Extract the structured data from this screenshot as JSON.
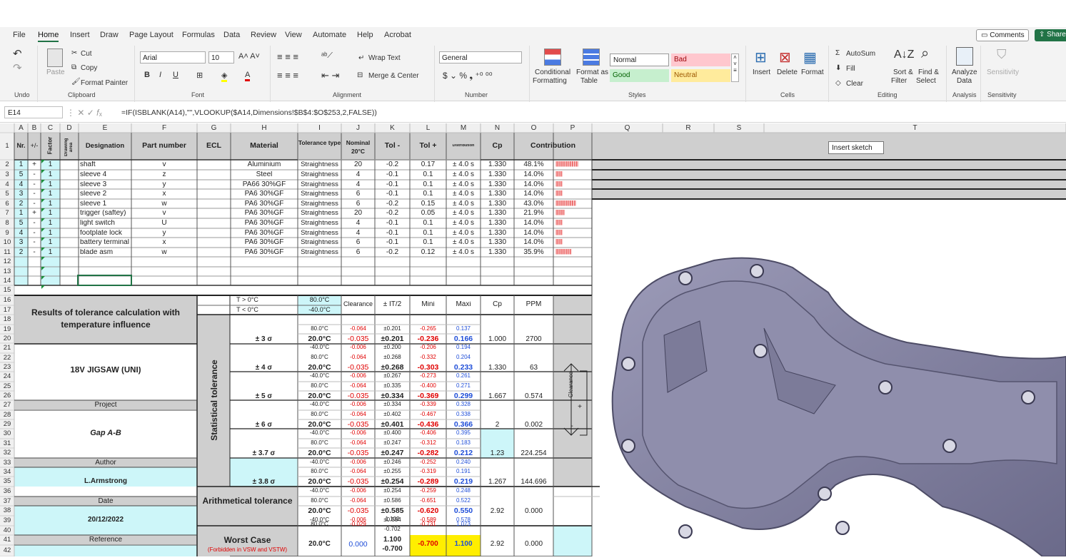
{
  "ribbon": {
    "tabs": [
      "File",
      "Home",
      "Insert",
      "Draw",
      "Page Layout",
      "Formulas",
      "Data",
      "Review",
      "View",
      "Automate",
      "Help",
      "Acrobat"
    ],
    "comments": "Comments",
    "share": "Share",
    "undo": "Undo",
    "clipboard": "Clipboard",
    "font": "Font",
    "alignment": "Alignment",
    "number": "Number",
    "styles": "Styles",
    "cells": "Cells",
    "editing": "Editing",
    "analysis": "Analysis",
    "sensitivity": "Sensitivity",
    "cut": "Cut",
    "copy": "Copy",
    "paste": "Paste",
    "format_painter": "Format Painter",
    "font_name": "Arial",
    "font_size": "10",
    "wrap": "Wrap Text",
    "merge": "Merge & Center",
    "num_format": "General",
    "cond1": "Conditional",
    "cond2": "Formatting",
    "fmt_table1": "Format as",
    "fmt_table2": "Table",
    "style_normal": "Normal",
    "style_bad": "Bad",
    "style_good": "Good",
    "style_neutral": "Neutral",
    "insert": "Insert",
    "delete": "Delete",
    "format": "Format",
    "autosum": "AutoSum",
    "fill": "Fill",
    "clear": "Clear",
    "sort1": "Sort &",
    "sort2": "Filter",
    "find1": "Find &",
    "find2": "Select",
    "analyze1": "Analyze",
    "analyze2": "Data",
    "sens": "Sensitivity",
    "colors": {
      "accent": "#217346",
      "style_bad_bg": "#ffc7ce",
      "style_bad_fg": "#9c0006",
      "style_good_bg": "#c6efce",
      "style_good_fg": "#006100",
      "style_neutral_bg": "#ffeb9c",
      "style_neutral_fg": "#9c5700"
    }
  },
  "formula_bar": {
    "cell": "E14",
    "formula": "=IF(ISBLANK(A14),\"\",VLOOKUP($A14,Dimensions!$B$4:$O$253,2,FALSE))"
  },
  "columns": [
    "A",
    "B",
    "C",
    "D",
    "E",
    "F",
    "G",
    "H",
    "I",
    "J",
    "K",
    "L",
    "M",
    "N",
    "O",
    "P",
    "Q",
    "R",
    "S",
    "T"
  ],
  "rows": [
    "1",
    "2",
    "3",
    "4",
    "5",
    "6",
    "7",
    "8",
    "9",
    "10",
    "11",
    "12",
    "13",
    "14",
    "15",
    "16",
    "17",
    "18",
    "19",
    "20",
    "21",
    "22",
    "23",
    "24",
    "25",
    "26",
    "27",
    "28",
    "29",
    "30",
    "31",
    "32",
    "33",
    "34",
    "35",
    "36",
    "37",
    "38",
    "39",
    "40",
    "41",
    "42"
  ],
  "header": {
    "nr": "Nr.",
    "sign": "+/-",
    "factor": "Factor",
    "drawing": "Drawing area",
    "designation": "Designation",
    "part": "Part number",
    "ecl": "ECL",
    "material": "Material",
    "tol_type": "Tolerance type",
    "nominal": "Nominal 20°C",
    "tol_minus": "Tol -",
    "tol_plus": "Tol +",
    "distribution": "Distribution",
    "cp": "Cp",
    "contribution": "Contribution",
    "s_col": "S",
    "tooltip": "Insert sketch"
  },
  "parts": [
    {
      "nr": "1",
      "sign": "+",
      "factor": "1",
      "des": "shaft",
      "part": "v",
      "mat": "Aluminium",
      "type": "Straightness",
      "nom": "20",
      "tm": "-0.2",
      "tp": "0.17",
      "dist": "± 4.0 s",
      "cp": "1.330",
      "contr": "48.1%",
      "bar": "||||||||||||||||||||"
    },
    {
      "nr": "5",
      "sign": "-",
      "factor": "1",
      "des": "sleeve 4",
      "part": "z",
      "mat": "Steel",
      "type": "Straightness",
      "nom": "4",
      "tm": "-0.1",
      "tp": "0.1",
      "dist": "± 4.0 s",
      "cp": "1.330",
      "contr": "14.0%",
      "bar": "||||||"
    },
    {
      "nr": "4",
      "sign": "-",
      "factor": "1",
      "des": "sleeve 3",
      "part": "y",
      "mat": "PA66 30%GF",
      "type": "Straightness",
      "nom": "4",
      "tm": "-0.1",
      "tp": "0.1",
      "dist": "± 4.0 s",
      "cp": "1.330",
      "contr": "14.0%",
      "bar": "||||||"
    },
    {
      "nr": "3",
      "sign": "-",
      "factor": "1",
      "des": "sleeve 2",
      "part": "x",
      "mat": "PA6 30%GF",
      "type": "Straightness",
      "nom": "6",
      "tm": "-0.1",
      "tp": "0.1",
      "dist": "± 4.0 s",
      "cp": "1.330",
      "contr": "14.0%",
      "bar": "||||||"
    },
    {
      "nr": "2",
      "sign": "-",
      "factor": "1",
      "des": "sleeve 1",
      "part": "w",
      "mat": "PA6 30%GF",
      "type": "Straightness",
      "nom": "6",
      "tm": "-0.2",
      "tp": "0.15",
      "dist": "± 4.0 s",
      "cp": "1.330",
      "contr": "43.0%",
      "bar": "||||||||||||||||||"
    },
    {
      "nr": "1",
      "sign": "+",
      "factor": "1",
      "des": "trigger (saftey)",
      "part": "v",
      "mat": "PA6 30%GF",
      "type": "Straightness",
      "nom": "20",
      "tm": "-0.2",
      "tp": "0.05",
      "dist": "± 4.0 s",
      "cp": "1.330",
      "contr": "21.9%",
      "bar": "||||||||"
    },
    {
      "nr": "5",
      "sign": "-",
      "factor": "1",
      "des": "light switch",
      "part": "U",
      "mat": "PA6 30%GF",
      "type": "Straightness",
      "nom": "4",
      "tm": "-0.1",
      "tp": "0.1",
      "dist": "± 4.0 s",
      "cp": "1.330",
      "contr": "14.0%",
      "bar": "||||||"
    },
    {
      "nr": "4",
      "sign": "-",
      "factor": "1",
      "des": "footplate lock",
      "part": "y",
      "mat": "PA6 30%GF",
      "type": "Straightness",
      "nom": "4",
      "tm": "-0.1",
      "tp": "0.1",
      "dist": "± 4.0 s",
      "cp": "1.330",
      "contr": "14.0%",
      "bar": "||||||"
    },
    {
      "nr": "3",
      "sign": "-",
      "factor": "1",
      "des": "battery terminal",
      "part": "x",
      "mat": "PA6 30%GF",
      "type": "Straightness",
      "nom": "6",
      "tm": "-0.1",
      "tp": "0.1",
      "dist": "± 4.0 s",
      "cp": "1.330",
      "contr": "14.0%",
      "bar": "||||||"
    },
    {
      "nr": "2",
      "sign": "-",
      "factor": "1",
      "des": "blade asm",
      "part": "w",
      "mat": "PA6 30%GF",
      "type": "Straightness",
      "nom": "6",
      "tm": "-0.2",
      "tp": "0.12",
      "dist": "± 4.0 s",
      "cp": "1.330",
      "contr": "35.9%",
      "bar": "||||||||||||||"
    }
  ],
  "results": {
    "title": "Results of tolerance calculation with temperature influence",
    "product": "18V JIGSAW (UNI)",
    "project_label": "Project",
    "project": "Gap A-B",
    "author_label": "Author",
    "author": "L.Armstrong",
    "date_label": "Date",
    "date": "20/12/2022",
    "reference_label": "Reference",
    "t_hi_label": "T > 0°C",
    "t_lo_label": "T < 0°C",
    "t_hi": "80.0°C",
    "t_lo": "-40.0°C",
    "clearance": "Clearance",
    "it2": "± IT/2",
    "mini": "Mini",
    "maxi": "Maxi",
    "cp": "Cp",
    "ppm": "PPM",
    "statistical": "Statistical tolerance",
    "arith": "Arithmetical tolerance",
    "worst": "Worst Case",
    "forbidden": "(Forbidden in VSW and VSTW)",
    "clearance_arrow": "Clearance"
  },
  "sigma_blocks": [
    {
      "label": "± 3 σ",
      "cp": "1.000",
      "ppm": "2700",
      "cl": [
        "-0.064",
        "-0.035",
        "-0.006"
      ],
      "it": [
        "±0.201",
        "±0.201",
        "±0.200"
      ],
      "mi": [
        "-0.265",
        "-0.236",
        "-0.206"
      ],
      "ma": [
        "0.137",
        "0.166",
        "0.194"
      ]
    },
    {
      "label": "± 4 σ",
      "cp": "1.330",
      "ppm": "63",
      "cl": [
        "-0.064",
        "-0.035",
        "-0.006"
      ],
      "it": [
        "±0.268",
        "±0.268",
        "±0.267"
      ],
      "mi": [
        "-0.332",
        "-0.303",
        "-0.273"
      ],
      "ma": [
        "0.204",
        "0.233",
        "0.261"
      ]
    },
    {
      "label": "± 5 σ",
      "cp": "1.667",
      "ppm": "0.574",
      "cl": [
        "-0.064",
        "-0.035",
        "-0.006"
      ],
      "it": [
        "±0.335",
        "±0.334",
        "±0.334"
      ],
      "mi": [
        "-0.400",
        "-0.369",
        "-0.339"
      ],
      "ma": [
        "0.271",
        "0.299",
        "0.328"
      ]
    },
    {
      "label": "± 6 σ",
      "cp": "2",
      "ppm": "0.002",
      "cl": [
        "-0.064",
        "-0.035",
        "-0.006"
      ],
      "it": [
        "±0.402",
        "±0.401",
        "±0.400"
      ],
      "mi": [
        "-0.467",
        "-0.436",
        "-0.406"
      ],
      "ma": [
        "0.338",
        "0.366",
        "0.395"
      ]
    },
    {
      "label": "± 3.7 σ",
      "cp": "1.23",
      "ppm": "224.254",
      "cl": [
        "-0.064",
        "-0.035",
        "-0.006"
      ],
      "it": [
        "±0.247",
        "±0.247",
        "±0.246"
      ],
      "mi": [
        "-0.312",
        "-0.282",
        "-0.252"
      ],
      "ma": [
        "0.183",
        "0.212",
        "0.240"
      ]
    },
    {
      "label": "± 3.8 σ",
      "cp": "1.267",
      "ppm": "144.696",
      "cl": [
        "-0.064",
        "-0.035",
        "-0.006"
      ],
      "it": [
        "±0.255",
        "±0.254",
        "±0.254"
      ],
      "mi": [
        "-0.319",
        "-0.289",
        "-0.259"
      ],
      "ma": [
        "0.191",
        "0.219",
        "0.248"
      ]
    },
    {
      "label": "",
      "cp": "2.92",
      "ppm": "0.000",
      "cl": [
        "-0.064",
        "-0.035",
        "-0.006"
      ],
      "it": [
        "±0.586",
        "±0.585",
        "±0.584"
      ],
      "mi": [
        "-0.651",
        "-0.620",
        "-0.589"
      ],
      "ma": [
        "0.522",
        "0.550",
        "0.578"
      ]
    }
  ],
  "temps": [
    "80.0°C",
    "20.0°C",
    "-40.0°C"
  ],
  "worst": {
    "t1": "80.0°C",
    "cl1": "-0.029",
    "it1a": "1.102",
    "it1b": "-0.702",
    "mi1": "-0.731",
    "ma1": "1.073",
    "t2": "20.0°C",
    "cl2": "0.000",
    "it2a": "1.100",
    "it2b": "-0.700",
    "mi2": "-0.700",
    "ma2": "1.100",
    "cp": "2.92",
    "ppm": "0.000"
  }
}
